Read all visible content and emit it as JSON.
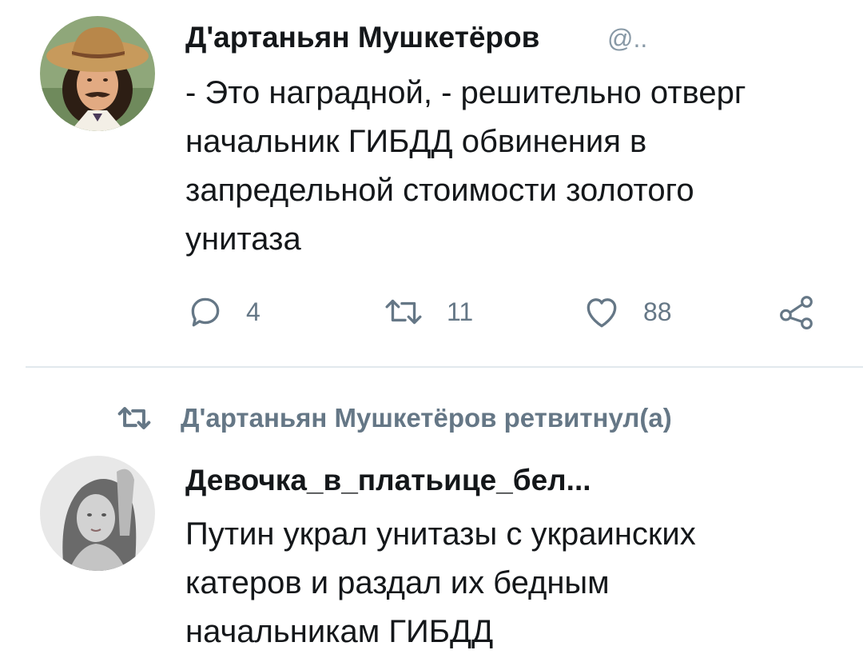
{
  "tweet1": {
    "author_name": "Д'артаньян Мушкетёров",
    "author_handle": "@..",
    "text": "- Это наградной, - решительно отверг\nначальник ГИБДД обвинения в\nзапредельной стоимости золотого\nунитаза",
    "actions": {
      "reply_icon": "reply-icon",
      "reply_count": "4",
      "retweet_icon": "retweet-icon",
      "retweet_count": "11",
      "like_icon": "heart-icon",
      "like_count": "88",
      "share_icon": "share-icon"
    }
  },
  "retweet_banner": {
    "icon": "retweet-icon",
    "text": "Д'артаньян Мушкетёров ретвитнул(а)"
  },
  "tweet2": {
    "author_name": "Девочка_в_платьице_бел...",
    "text": "Путин украл унитазы с украинских\nкатеров и раздал их бедным\nначальникам ГИБДД"
  },
  "colors": {
    "text_primary": "#14171a",
    "text_secondary": "#657786",
    "divider": "#e1e8ed"
  }
}
